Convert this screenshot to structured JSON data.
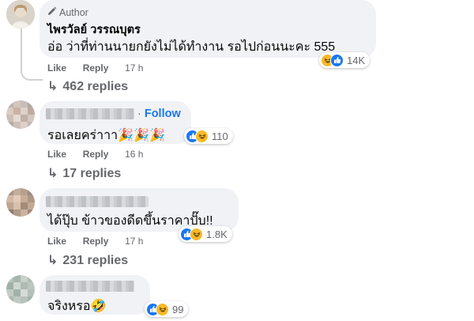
{
  "actions": {
    "like": "Like",
    "reply": "Reply"
  },
  "comments": [
    {
      "badge": "Author",
      "name": "ไพรวัลย์ วรรณบุตร",
      "text": "อ่อ ว่าที่ท่านนายกยังไม่ได้ทำงาน รอไปก่อนนะคะ 555",
      "time": "17 h",
      "reactions": "14K",
      "replies": "462 replies"
    },
    {
      "follow": "Follow",
      "text": "รอเลยคร่าาา🎉🎉🎉",
      "time": "16 h",
      "reactions": "110",
      "replies": "17 replies"
    },
    {
      "text": "ได้ปุ๊บ ข้าวของดีดขึ้นราคาปั๊บ!!",
      "time": "17 h",
      "reactions": "1.8K",
      "replies": "231 replies"
    },
    {
      "text": "จริงหรอ🤣",
      "reactions": "99"
    }
  ],
  "colors": {
    "bubble": "#f0f2f5",
    "link": "#1877f2",
    "meta": "#65676b",
    "like": "#1877f2",
    "haha": "#f7b928"
  }
}
